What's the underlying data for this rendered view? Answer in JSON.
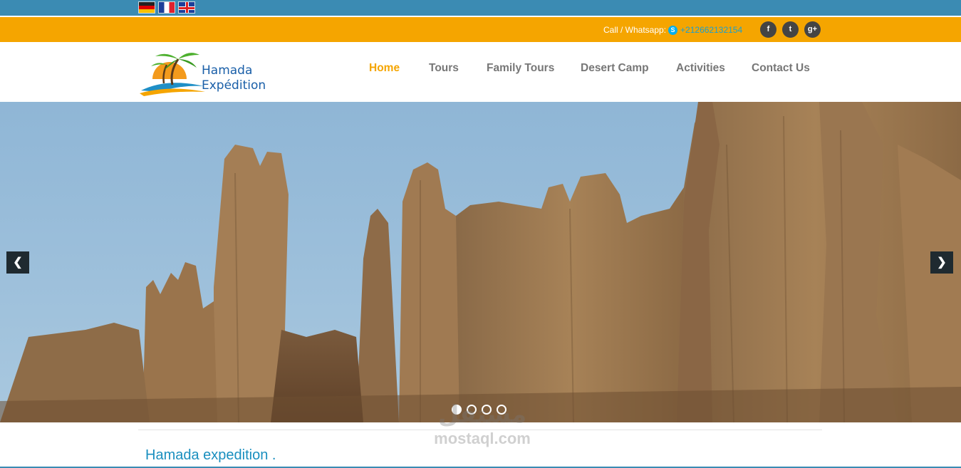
{
  "languages": [
    "Deutsch",
    "Français",
    "English"
  ],
  "contact": {
    "call_label": "Call / Whatsapp:",
    "skype_icon_letter": "S",
    "phone": "+212662132154"
  },
  "socials": [
    {
      "name": "facebook",
      "glyph": "f"
    },
    {
      "name": "twitter",
      "glyph": "t"
    },
    {
      "name": "google-plus",
      "glyph": "g+"
    }
  ],
  "logo": {
    "line1": "Hamada",
    "line2": "Expédition"
  },
  "nav": {
    "items": [
      "Home",
      "Tours",
      "Family Tours",
      "Desert Camp",
      "Activities",
      "Contact Us"
    ],
    "active": "Home"
  },
  "slider": {
    "prev_glyph": "❮",
    "next_glyph": "❯",
    "slide_count": 4,
    "active_slide": 1
  },
  "intro": {
    "title": "Hamada expedition ."
  },
  "watermark": {
    "arabic": "مستقل",
    "latin": "mostaql.com"
  },
  "colors": {
    "topbar": "#3b8bb3",
    "orangebar": "#f5a500",
    "nav_active": "#f5a500",
    "nav_default": "#777777",
    "intro_title": "#1a8fbf"
  }
}
